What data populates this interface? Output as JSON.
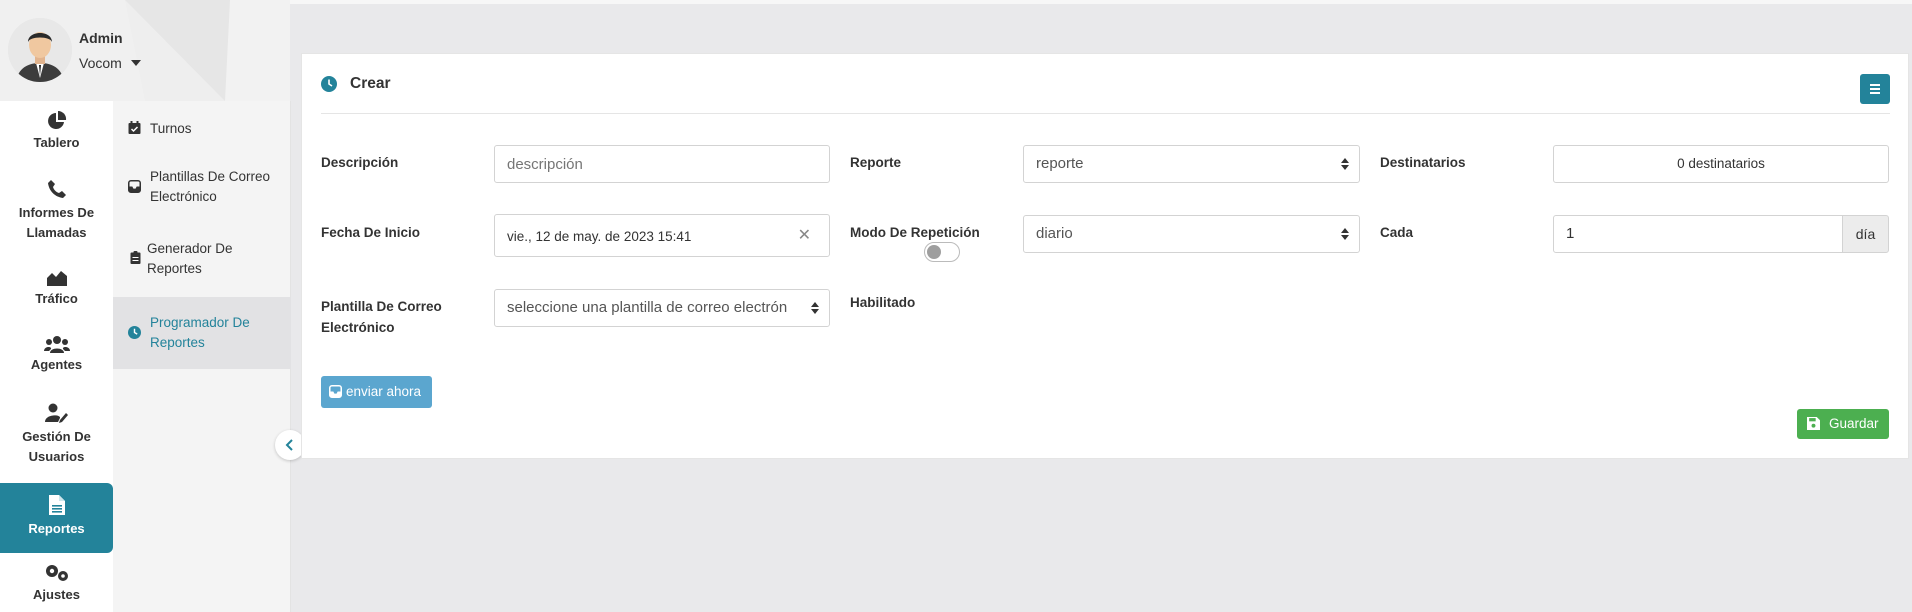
{
  "user": {
    "name": "Admin",
    "org": "Vocom"
  },
  "nav": {
    "items": [
      {
        "label": "Tablero",
        "icon": "pie-chart-icon"
      },
      {
        "label": "Informes De Llamadas",
        "icon": "phone-icon"
      },
      {
        "label": "Tráfico",
        "icon": "area-chart-icon"
      },
      {
        "label": "Agentes",
        "icon": "users-icon"
      },
      {
        "label": "Gestión De Usuarios",
        "icon": "user-edit-icon"
      },
      {
        "label": "Reportes",
        "icon": "file-icon"
      },
      {
        "label": "Ajustes",
        "icon": "gears-icon"
      }
    ],
    "active_color": "#23839a"
  },
  "subnav": {
    "items": [
      {
        "label": "Turnos",
        "icon": "calendar-check-icon"
      },
      {
        "label": "Plantillas De Correo Electrónico",
        "icon": "mail-inbox-icon"
      },
      {
        "label": "Generador De Reportes",
        "icon": "clipboard-icon"
      },
      {
        "label": "Programador De Reportes",
        "icon": "clock-icon"
      }
    ]
  },
  "form": {
    "title": "Crear",
    "descripcion": {
      "label": "Descripción",
      "placeholder": "descripción"
    },
    "reporte": {
      "label": "Reporte",
      "value": "reporte"
    },
    "destinatarios": {
      "label": "Destinatarios",
      "value": "0 destinatarios"
    },
    "fecha_inicio": {
      "label": "Fecha De Inicio",
      "value": "vie., 12 de may. de 2023 15:41"
    },
    "modo_repeticion": {
      "label": "Modo De Repetición",
      "value": "diario"
    },
    "cada": {
      "label": "Cada",
      "value": "1",
      "unit": "día"
    },
    "plantilla": {
      "label": "Plantilla De Correo Electrónico",
      "value": "seleccione una plantilla de correo electrón"
    },
    "habilitado": {
      "label": "Habilitado",
      "enabled": false
    },
    "send_now_label": "enviar ahora",
    "save_label": "Guardar"
  },
  "colors": {
    "accent": "#23839a",
    "send": "#5ba6cf",
    "save": "#4caf50"
  }
}
